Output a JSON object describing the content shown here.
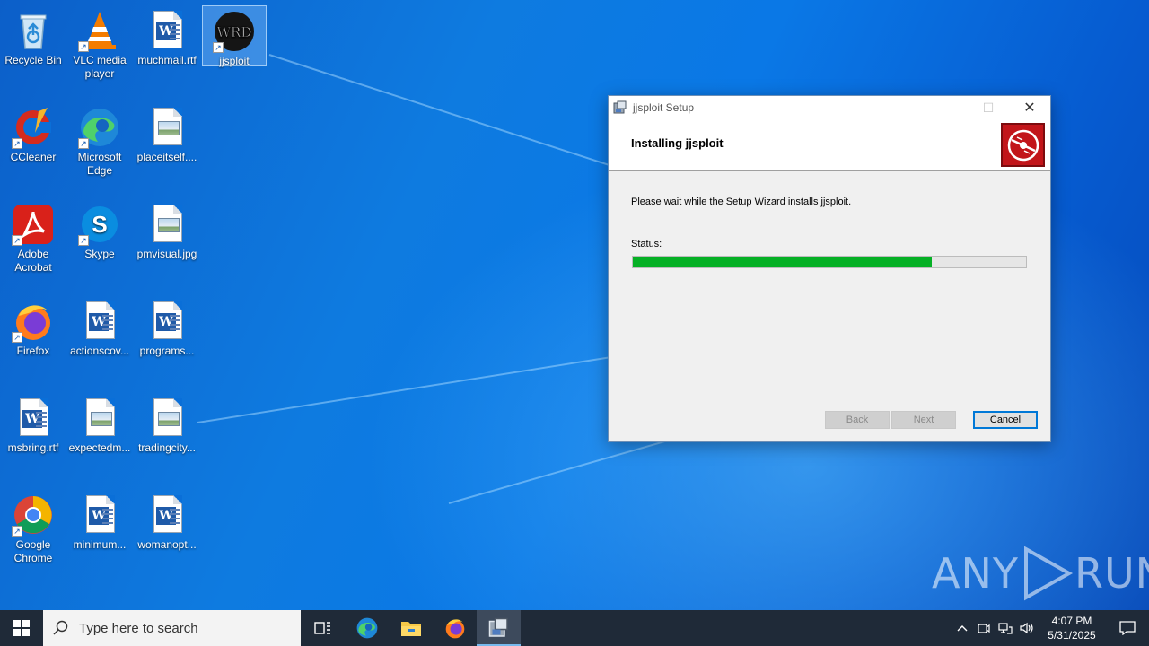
{
  "desktop": {
    "icons": [
      {
        "label": "Recycle Bin",
        "icon": "recycle-bin-icon"
      },
      {
        "label": "VLC media player",
        "icon": "vlc-icon"
      },
      {
        "label": "muchmail.rtf",
        "icon": "word-document-icon"
      },
      {
        "label": "jjsploit",
        "icon": "jjsploit-icon"
      },
      {
        "label": "CCleaner",
        "icon": "ccleaner-icon"
      },
      {
        "label": "Microsoft Edge",
        "icon": "edge-icon"
      },
      {
        "label": "placeitself....",
        "icon": "image-file-icon"
      },
      {
        "label": "Adobe Acrobat",
        "icon": "acrobat-icon"
      },
      {
        "label": "Skype",
        "icon": "skype-icon"
      },
      {
        "label": "pmvisual.jpg",
        "icon": "image-file-icon"
      },
      {
        "label": "Firefox",
        "icon": "firefox-icon"
      },
      {
        "label": "actionscov...",
        "icon": "word-document-icon"
      },
      {
        "label": "programs...",
        "icon": "word-document-icon"
      },
      {
        "label": "msbring.rtf",
        "icon": "word-document-icon"
      },
      {
        "label": "expectedm...",
        "icon": "image-file-icon"
      },
      {
        "label": "tradingcity...",
        "icon": "image-file-icon"
      },
      {
        "label": "Google Chrome",
        "icon": "chrome-icon"
      },
      {
        "label": "minimum...",
        "icon": "word-document-icon"
      },
      {
        "label": "womanopt...",
        "icon": "word-document-icon"
      }
    ]
  },
  "setup_window": {
    "title": "jjsploit Setup",
    "header_title": "Installing jjsploit",
    "message": "Please wait while the Setup Wizard installs jjsploit.",
    "status_label": "Status:",
    "progress_fraction": 0.76,
    "buttons": {
      "back": "Back",
      "next": "Next",
      "cancel": "Cancel"
    },
    "controls": {
      "minimize": "—",
      "maximize": "☐",
      "close": "✕"
    }
  },
  "watermark": {
    "text_left": "ANY",
    "text_right": "RUN"
  },
  "taskbar": {
    "search_placeholder": "Type here to search",
    "apps": [
      "task-view-icon",
      "edge-icon",
      "file-explorer-icon",
      "firefox-icon",
      "installer-icon"
    ],
    "clock_time": "4:07 PM",
    "clock_date": "5/31/2025",
    "colors": {
      "background": "#1f2a38",
      "active_indicator": "#76b9ed"
    }
  },
  "colors": {
    "progress_fill": "#06b025",
    "desktop_blue": "#0a6fd8",
    "logo_red": "#c2151a"
  }
}
